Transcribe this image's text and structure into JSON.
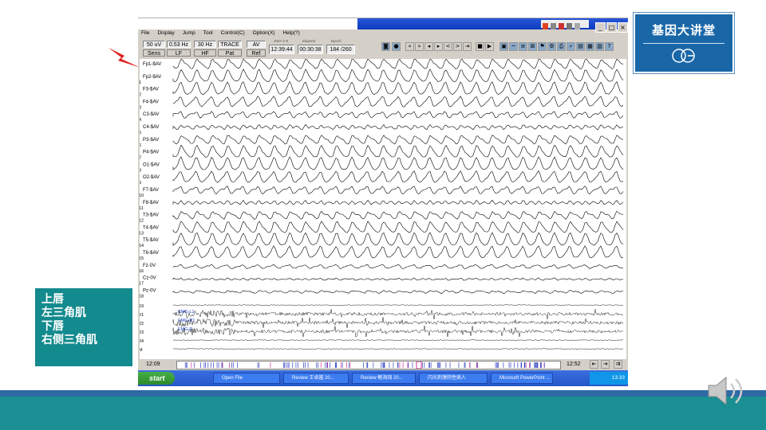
{
  "logo": {
    "title": "基因大讲堂"
  },
  "annotation": {
    "lines": [
      "上唇",
      "左三角肌",
      "下唇",
      "右侧三角肌"
    ]
  },
  "menu": [
    "File",
    "Display",
    "Jump",
    "Tool",
    "Control(C)",
    "Option(X)",
    "Help(?)"
  ],
  "toolbar": {
    "cells": [
      "50 uV",
      "0.53 Hz",
      "30 Hz",
      "TRACE",
      "AV",
      "Sens",
      "LF",
      "HF",
      "Pat",
      "Ref"
    ],
    "date_caption": "2007-2-9",
    "time": "12:39:44",
    "elapsed_caption": "Elapsed",
    "elapsed": "00:30:38",
    "epoch_caption": "Epoch",
    "epoch": "184 /260"
  },
  "channels": [
    {
      "num": "",
      "label": "Fp1-$AV"
    },
    {
      "num": "1",
      "label": "Fp2-$AV"
    },
    {
      "num": "2",
      "label": "F3-$AV"
    },
    {
      "num": "3",
      "label": "F4-$AV"
    },
    {
      "num": "4",
      "label": "C3-$AV"
    },
    {
      "num": "5",
      "label": "C4-$AV"
    },
    {
      "num": "6",
      "label": "P3-$AV"
    },
    {
      "num": "7",
      "label": "P4-$AV"
    },
    {
      "num": "8",
      "label": "O1-$AV"
    },
    {
      "num": "9",
      "label": "O2-$AV"
    },
    {
      "num": "10",
      "label": "F7-$AV"
    },
    {
      "num": "11",
      "label": "F8-$AV"
    },
    {
      "num": "12",
      "label": "T3-$AV"
    },
    {
      "num": "13",
      "label": "T4-$AV"
    },
    {
      "num": "14",
      "label": "T5-$AV"
    },
    {
      "num": "15",
      "label": "T6-$AV"
    },
    {
      "num": "16",
      "label": "Fz-0V"
    },
    {
      "num": "17",
      "label": "Cz-0V"
    },
    {
      "num": "18",
      "label": "Pz-0V"
    }
  ],
  "emg": [
    {
      "num": "19",
      "label": ""
    },
    {
      "num": "21",
      "label": "EMG-L1"
    },
    {
      "num": "22",
      "label": "EMG-R1"
    },
    {
      "num": "23",
      "label": "EMG-R"
    },
    {
      "num": "24",
      "label": ""
    },
    {
      "num": "M",
      "label": ""
    }
  ],
  "status": {
    "left_time": "12:09",
    "right_time": "12:52"
  },
  "taskbar": {
    "start": "start",
    "tasks": [
      "Open File",
      "Review  王卓越  20...",
      "Review  鲍海琦  20...",
      "闪光刺激阴性病人",
      "Microsoft PowerPoint ..."
    ],
    "clock": "13:33"
  },
  "colors": {
    "slide_teal": "#138a8d",
    "slide_blue": "#2f6aa6",
    "logo_blue": "#1a67a8",
    "arrow_red": "#e0201e",
    "emg_label_blue": "#1a3cd0"
  }
}
